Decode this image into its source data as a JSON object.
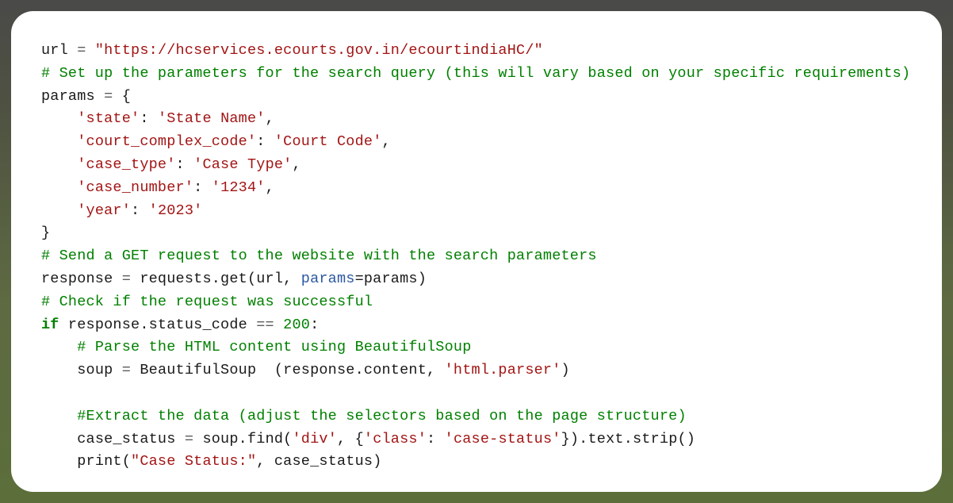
{
  "code": {
    "l1_var": "url ",
    "l1_op": "= ",
    "l1_str": "\"https://hcservices.ecourts.gov.in/ecourtindiaHC/\"",
    "l2_cmt": "# Set up the parameters for the search query (this will vary based on your specific requirements)",
    "l3_var": "params ",
    "l3_op": "= ",
    "l3_brace": "{",
    "l4_indent": "    ",
    "l4_key": "'state'",
    "l4_colon": ": ",
    "l4_val": "'State Name'",
    "l4_comma": ",",
    "l5_indent": "    ",
    "l5_key": "'court_complex_code'",
    "l5_colon": ": ",
    "l5_val": "'Court Code'",
    "l5_comma": ",",
    "l6_indent": "    ",
    "l6_key": "'case_type'",
    "l6_colon": ": ",
    "l6_val": "'Case Type'",
    "l6_comma": ",",
    "l7_indent": "    ",
    "l7_key": "'case_number'",
    "l7_colon": ": ",
    "l7_val": "'1234'",
    "l7_comma": ",",
    "l8_indent": "    ",
    "l8_key": "'year'",
    "l8_colon": ": ",
    "l8_val": "'2023'",
    "l9_brace": "}",
    "l10_cmt": "# Send a GET request to the website with the search parameters",
    "l11_a": "response ",
    "l11_op": "= ",
    "l11_b": "requests.get(url, ",
    "l11_param": "params",
    "l11_c": "=params)",
    "l12_cmt": "# Check if the request was successful",
    "l13_if": "if",
    "l13_a": " response.status_code ",
    "l13_op": "== ",
    "l13_num": "200",
    "l13_colon": ":",
    "l14_indent": "    ",
    "l14_cmt": "# Parse the HTML content using BeautifulSoup",
    "l15_indent": "    ",
    "l15_a": "soup ",
    "l15_op": "= ",
    "l15_b": "BeautifulSoup  (response.content, ",
    "l15_str": "'html.parser'",
    "l15_c": ")",
    "l16_blank": "",
    "l17_indent": "    ",
    "l17_cmt": "#Extract the data (adjust the selectors based on the page structure)",
    "l18_indent": "    ",
    "l18_a": "case_status ",
    "l18_op": "= ",
    "l18_b": "soup.find(",
    "l18_str1": "'div'",
    "l18_c": ", {",
    "l18_str2": "'class'",
    "l18_d": ": ",
    "l18_str3": "'case-status'",
    "l18_e": "}).text.strip()",
    "l19_indent": "    ",
    "l19_a": "print(",
    "l19_str": "\"Case Status:\"",
    "l19_b": ", case_status)"
  }
}
